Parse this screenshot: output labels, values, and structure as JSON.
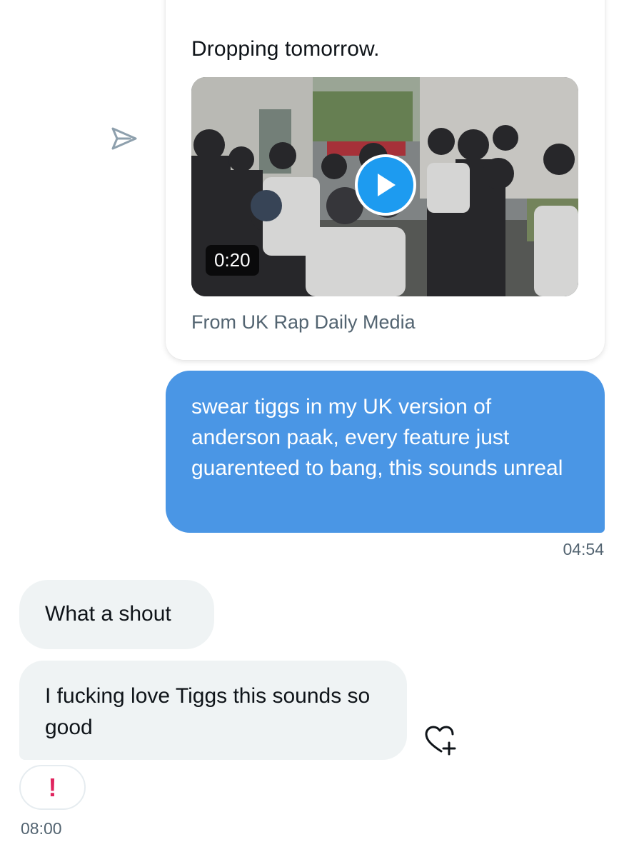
{
  "shared_tweet": {
    "text": "Dropping tomorrow.",
    "video_duration": "0:20",
    "source": "From UK Rap Daily Media"
  },
  "messages": [
    {
      "direction": "outgoing",
      "text": "swear tiggs in my UK version of anderson paak, every feature just guarenteed to bang, this sounds unreal",
      "time": "04:54"
    },
    {
      "direction": "incoming",
      "text": "What a shout"
    },
    {
      "direction": "incoming",
      "text": "I fucking love Tiggs this sounds so good",
      "reaction": "!",
      "time": "08:00"
    }
  ],
  "icons": {
    "share": "share-dm-icon",
    "play": "play-icon",
    "add_reaction": "heart-plus-icon",
    "reaction": "exclamation-icon"
  },
  "colors": {
    "outgoing_bubble": "#4a96e5",
    "incoming_bubble": "#eff3f4",
    "play_button": "#1d9bf0",
    "reaction": "#e0245e",
    "meta_text": "#536471"
  }
}
